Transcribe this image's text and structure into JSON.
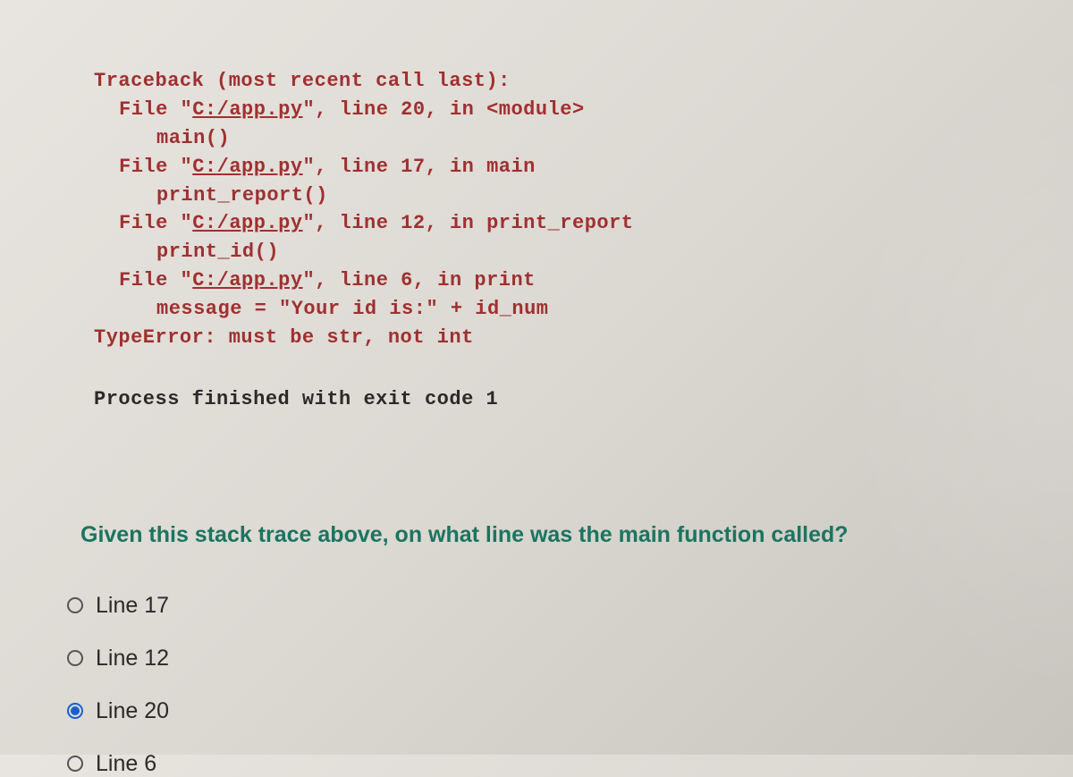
{
  "traceback": {
    "header": "Traceback (most recent call last):",
    "frames": [
      {
        "file_prefix": "File \"",
        "file_link": "C:/app.py",
        "file_suffix": "\", line 20, in <module>",
        "code": "main()"
      },
      {
        "file_prefix": "File  \"",
        "file_link": "C:/app.py",
        "file_suffix": "\", line 17, in main",
        "code": "print_report()"
      },
      {
        "file_prefix": "File \"",
        "file_link": "C:/app.py",
        "file_suffix": "\", line 12, in print_report",
        "code": "print_id()"
      },
      {
        "file_prefix": "File \"",
        "file_link": "C:/app.py",
        "file_suffix": "\", line 6, in print",
        "code": "message = \"Your id is:\" + id_num"
      }
    ],
    "error": "TypeError: must be str, not int"
  },
  "process_line": "Process finished with exit code 1",
  "question": "Given this stack trace above, on what line was the main function called?",
  "options": [
    {
      "label": "Line 17",
      "selected": false
    },
    {
      "label": "Line 12",
      "selected": false
    },
    {
      "label": "Line 20",
      "selected": true
    },
    {
      "label": "Line 6",
      "selected": false
    }
  ]
}
